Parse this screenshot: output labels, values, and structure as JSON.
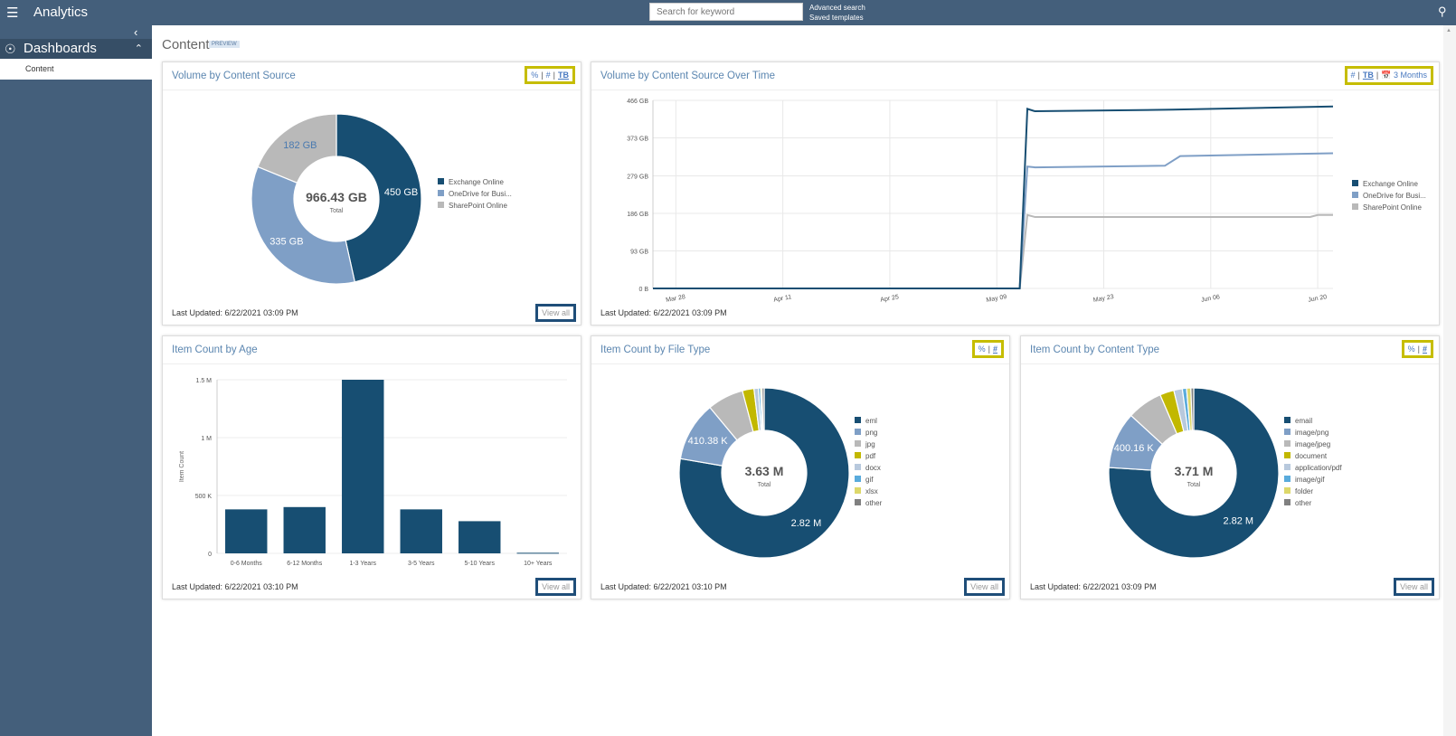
{
  "header": {
    "app_title": "Analytics",
    "search_placeholder": "Search for keyword",
    "advanced_search": "Advanced search",
    "saved_templates": "Saved templates"
  },
  "sidebar": {
    "section": "Dashboards",
    "items": [
      {
        "label": "Content"
      }
    ]
  },
  "page": {
    "title": "Content",
    "badge": "PREVIEW"
  },
  "colors": {
    "topbar": "#445f7b",
    "accent": "#5b86b0",
    "toggle_highlight": "#c6bd00",
    "viewall_highlight": "#1f4e79"
  },
  "cards": {
    "volume_source": {
      "title": "Volume by Content Source",
      "toggles": [
        "%",
        "#",
        "TB"
      ],
      "active": "TB",
      "updated": "Last Updated: 6/22/2021 03:09 PM",
      "view_all": "View all"
    },
    "volume_time": {
      "title": "Volume by Content Source Over Time",
      "toggles": [
        "#",
        "TB",
        "3 Months"
      ],
      "active": "TB",
      "updated": "Last Updated: 6/22/2021 03:09 PM"
    },
    "item_age": {
      "title": "Item Count by Age",
      "updated": "Last Updated: 6/22/2021 03:10 PM",
      "view_all": "View all"
    },
    "file_type": {
      "title": "Item Count by File Type",
      "toggles": [
        "%",
        "#"
      ],
      "active": "#",
      "updated": "Last Updated: 6/22/2021 03:10 PM",
      "view_all": "View all"
    },
    "content_type": {
      "title": "Item Count by Content Type",
      "toggles": [
        "%",
        "#"
      ],
      "active": "#",
      "updated": "Last Updated: 6/22/2021 03:09 PM",
      "view_all": "View all"
    }
  },
  "chart_data": [
    {
      "type": "pie",
      "donut": true,
      "center_value": "966.43 GB",
      "center_label": "Total",
      "legend": "right",
      "slices": [
        {
          "name": "Exchange Online",
          "value": 450,
          "label": "450 GB",
          "color": "#174e72"
        },
        {
          "name": "OneDrive for Busi...",
          "value": 335,
          "label": "335 GB",
          "color": "#7f9fc6"
        },
        {
          "name": "SharePoint Online",
          "value": 182,
          "label": "182 GB",
          "color": "#b9b9b9"
        }
      ]
    },
    {
      "type": "line",
      "legend": "right",
      "grid": true,
      "xlim": [
        "2021-03-25",
        "2021-06-22"
      ],
      "ylim": [
        0,
        466
      ],
      "yticks": [
        "0 B",
        "93 GB",
        "186 GB",
        "279 GB",
        "373 GB",
        "466 GB"
      ],
      "ytick_values": [
        0,
        93,
        186,
        279,
        373,
        466
      ],
      "xticks": [
        "Mar 28",
        "Apr 11",
        "Apr 25",
        "May 09",
        "May 23",
        "Jun 06",
        "Jun 20"
      ],
      "xtick_dates": [
        "2021-03-28",
        "2021-04-11",
        "2021-04-25",
        "2021-05-09",
        "2021-05-23",
        "2021-06-06",
        "2021-06-20"
      ],
      "series": [
        {
          "name": "Exchange Online",
          "color": "#174e72",
          "points": [
            [
              "2021-03-25",
              0
            ],
            [
              "2021-05-12",
              0
            ],
            [
              "2021-05-13",
              445
            ],
            [
              "2021-05-14",
              439
            ],
            [
              "2021-06-01",
              443
            ],
            [
              "2021-06-22",
              451
            ]
          ]
        },
        {
          "name": "OneDrive for Busi...",
          "color": "#7f9fc6",
          "points": [
            [
              "2021-03-25",
              0
            ],
            [
              "2021-05-12",
              0
            ],
            [
              "2021-05-13",
              302
            ],
            [
              "2021-05-14",
              300
            ],
            [
              "2021-05-31",
              304
            ],
            [
              "2021-06-02",
              328
            ],
            [
              "2021-06-22",
              335
            ]
          ]
        },
        {
          "name": "SharePoint Online",
          "color": "#b9b9b9",
          "points": [
            [
              "2021-03-25",
              0
            ],
            [
              "2021-05-12",
              0
            ],
            [
              "2021-05-13",
              182
            ],
            [
              "2021-05-14",
              177
            ],
            [
              "2021-06-19",
              177
            ],
            [
              "2021-06-20",
              182
            ],
            [
              "2021-06-22",
              182
            ]
          ]
        }
      ]
    },
    {
      "type": "bar",
      "ylabel": "Item Count",
      "ylim": [
        0,
        1500000
      ],
      "yticks": [
        "0",
        "500 K",
        "1 M",
        "1.5 M"
      ],
      "ytick_values": [
        0,
        500000,
        1000000,
        1500000
      ],
      "categories": [
        "0-6 Months",
        "6-12 Months",
        "1-3 Years",
        "3-5 Years",
        "5-10 Years",
        "10+ Years"
      ],
      "values": [
        380000,
        400000,
        1500000,
        380000,
        278000,
        5000
      ],
      "color": "#174e72"
    },
    {
      "type": "pie",
      "donut": true,
      "center_value": "3.63 M",
      "center_label": "Total",
      "legend": "right",
      "slices": [
        {
          "name": "eml",
          "value": 2820000,
          "label": "2.82 M",
          "color": "#174e72"
        },
        {
          "name": "png",
          "value": 410380,
          "label": "410.38 K",
          "color": "#7f9fc6"
        },
        {
          "name": "jpg",
          "value": 250000,
          "color": "#b9b9b9"
        },
        {
          "name": "pdf",
          "value": 80000,
          "color": "#c2b800"
        },
        {
          "name": "docx",
          "value": 30000,
          "color": "#b8c9dd"
        },
        {
          "name": "gif",
          "value": 15000,
          "color": "#5aabdc"
        },
        {
          "name": "xlsx",
          "value": 10000,
          "color": "#ddd86a"
        },
        {
          "name": "other",
          "value": 15000,
          "color": "#808080"
        }
      ]
    },
    {
      "type": "pie",
      "donut": true,
      "center_value": "3.71 M",
      "center_label": "Total",
      "legend": "right",
      "slices": [
        {
          "name": "email",
          "value": 2820000,
          "label": "2.82 M",
          "color": "#174e72"
        },
        {
          "name": "image/png",
          "value": 400160,
          "label": "400.16 K",
          "color": "#7f9fc6"
        },
        {
          "name": "image/jpeg",
          "value": 250000,
          "color": "#b9b9b9"
        },
        {
          "name": "document",
          "value": 100000,
          "color": "#c2b800"
        },
        {
          "name": "application/pdf",
          "value": 60000,
          "color": "#b8c9dd"
        },
        {
          "name": "image/gif",
          "value": 30000,
          "color": "#5aabdc"
        },
        {
          "name": "folder",
          "value": 30000,
          "color": "#ddd86a"
        },
        {
          "name": "other",
          "value": 20000,
          "color": "#808080"
        }
      ]
    }
  ]
}
